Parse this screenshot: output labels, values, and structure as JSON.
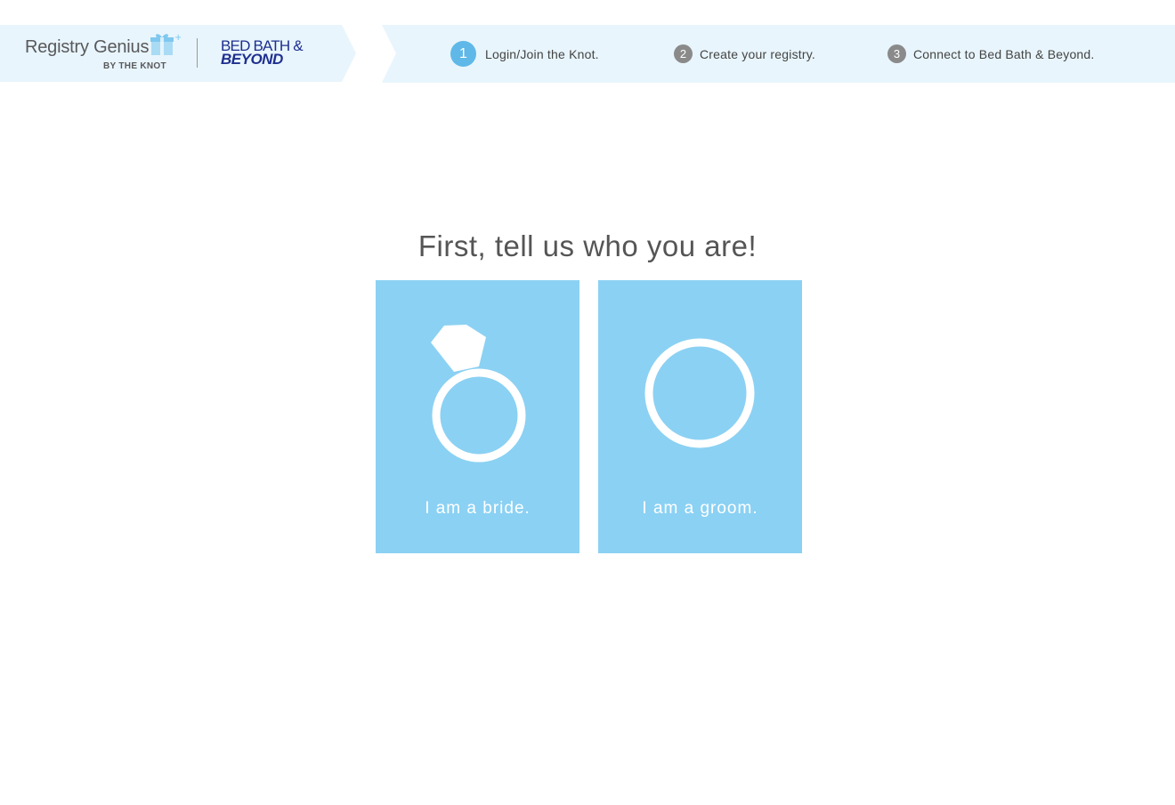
{
  "header": {
    "brand_title": "Registry Genius",
    "brand_subtitle": "BY THE KNOT",
    "partner_logo_line1": "BED BATH &",
    "partner_logo_line2": "BEYOND",
    "partner_logo_name": "bed-bath-beyond-logo",
    "brand_icon": "gift-box-icon"
  },
  "steps": [
    {
      "number": "1",
      "label": "Login/Join the Knot.",
      "active": true
    },
    {
      "number": "2",
      "label": "Create your registry.",
      "active": false
    },
    {
      "number": "3",
      "label": "Connect to Bed Bath & Beyond.",
      "active": false
    }
  ],
  "main": {
    "headline": "First, tell us who you are!",
    "options": [
      {
        "label": "I am a bride.",
        "icon": "engagement-ring-icon"
      },
      {
        "label": "I am a groom.",
        "icon": "wedding-band-icon"
      }
    ]
  },
  "colors": {
    "header_bg": "#e8f5fc",
    "card_bg": "#8bd1f3",
    "active_step": "#5fb8e8",
    "inactive_step": "#8a8a8a",
    "partner_blue": "#1e2f8f"
  }
}
